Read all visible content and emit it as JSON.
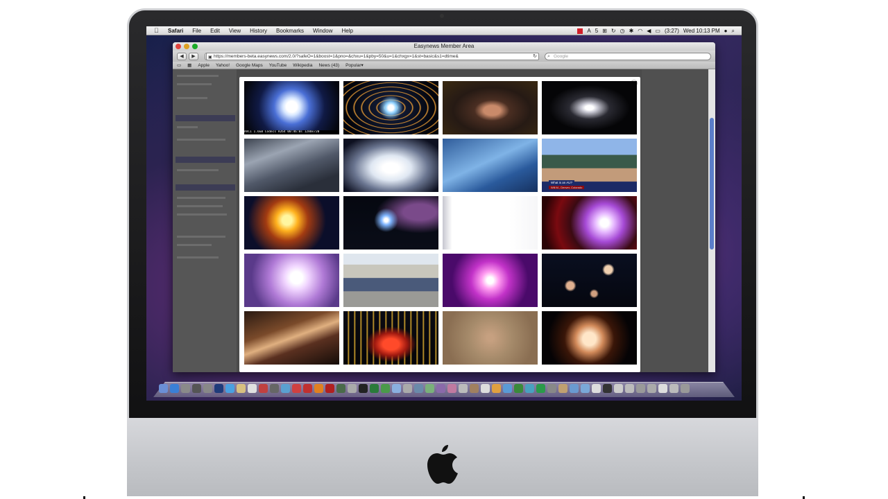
{
  "menubar": {
    "app_name": "Safari",
    "items": [
      "File",
      "Edit",
      "View",
      "History",
      "Bookmarks",
      "Window",
      "Help"
    ],
    "status": {
      "adobe_badge": "5",
      "battery": "(3:27)",
      "clock": "Wed 10:13 PM"
    }
  },
  "window": {
    "title": "Easynews Member Area",
    "address": "https://members-beta.easynews.com/2.0/?safeO=1&boost=1&pno=&chxu=1&pby=50&u=1&chxgx=1&st=basic&s1=dtime&",
    "search_placeholder": "Google"
  },
  "bookmarks": [
    "Apple",
    "Yahoo!",
    "Google Maps",
    "YouTube",
    "Wikipedia",
    "News (43)",
    "Popular"
  ],
  "lightbox": {
    "close_label": "×",
    "thumb_caption": "AVC1 1.6GB Codecs H264 00:46:0s 1280x720",
    "thumb8_title": "What is an AU?",
    "thumb8_subtitle": "Will M., Denver, Colorado"
  },
  "colors": {
    "menubar_red": "#d0202a",
    "scroll_thumb": "#5b7ec9"
  }
}
